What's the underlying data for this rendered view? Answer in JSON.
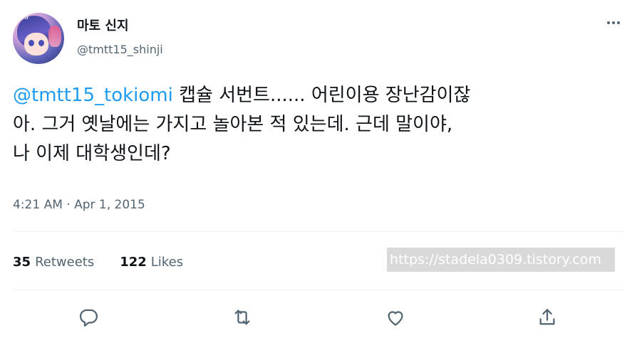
{
  "author": {
    "display_name": "마토 신지",
    "handle": "@tmtt15_shinji",
    "avatar_tag": "itta"
  },
  "tweet": {
    "mention": "@tmtt15_tokiomi",
    "text_line1": " 캡슐 서번트...... 어린이용 장난감이잖",
    "text_line2": "아. 그거 옛날에는 가지고 놀아본 적 있는데. 근데 말이야,",
    "text_line3": "나 이제 대학생인데?",
    "timestamp": "4:21 AM · Apr 1, 2015"
  },
  "stats": {
    "retweets_count": "35",
    "retweets_label": "Retweets",
    "likes_count": "122",
    "likes_label": "Likes"
  },
  "watermark": "https://stadela0309.tistory.com",
  "icons": {
    "more": "more-horizontal-icon",
    "reply": "reply-icon",
    "retweet": "retweet-icon",
    "like": "heart-icon",
    "share": "share-icon"
  },
  "colors": {
    "link": "#1d9bf0",
    "secondary_text": "#536471",
    "primary_text": "#0f1419"
  }
}
